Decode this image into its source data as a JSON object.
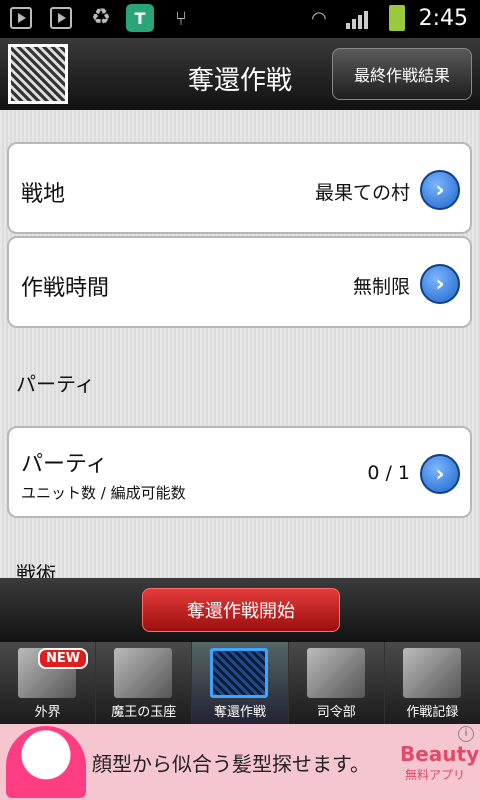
{
  "status_bar": {
    "time": "2:45",
    "icons": [
      "play-store-icon",
      "play-store-icon",
      "recycle-icon",
      "shield-t-icon",
      "usb-icon",
      "wifi-icon",
      "signal-icon",
      "battery-charging-icon"
    ],
    "shield_letter": "T"
  },
  "header": {
    "title": "奪還作戦",
    "final_results_label": "最終作戦結果"
  },
  "settings": [
    {
      "label": "戦地",
      "value": "最果ての村"
    },
    {
      "label": "作戦時間",
      "value": "無制限"
    }
  ],
  "party_section": {
    "heading": "パーティ",
    "row_label": "パーティ",
    "row_sub": "ユニット数 / 編成可能数",
    "row_value": "0 / 1"
  },
  "partial_section_heading": "戦術",
  "start_button_label": "奪還作戦開始",
  "tabs": [
    {
      "label": "外界",
      "badge": "NEW"
    },
    {
      "label": "魔王の玉座"
    },
    {
      "label": "奪還作戦",
      "active": true
    },
    {
      "label": "司令部"
    },
    {
      "label": "作戦記録"
    }
  ],
  "ad": {
    "text": "顔型から似合う髪型探せます。",
    "brand_line1": "Beauty",
    "brand_line2": "無料アプリ",
    "info": "i"
  },
  "colors": {
    "accent_blue": "#1d63c9",
    "start_red": "#c61f1f",
    "ad_pink": "#f5c6cf"
  }
}
